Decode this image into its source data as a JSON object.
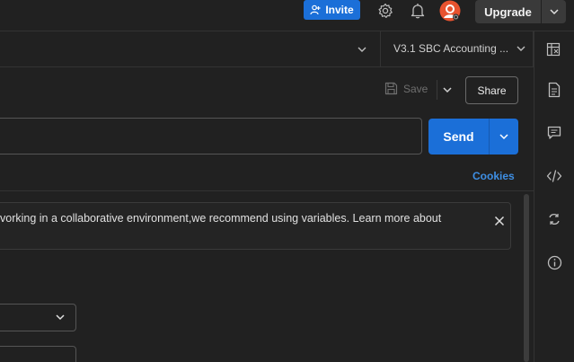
{
  "topbar": {
    "invite_label": "Invite",
    "upgrade_label": "Upgrade"
  },
  "environment": {
    "selected": "V3.1 SBC Accounting ..."
  },
  "request": {
    "save_label": "Save",
    "share_label": "Share",
    "url_value": "",
    "send_label": "Send",
    "cookies_label": "Cookies"
  },
  "banner": {
    "text": "vorking in a collaborative environment,we recommend using variables. Learn more about"
  },
  "colors": {
    "accent": "#1b6fd8",
    "link": "#3e8fe4",
    "avatar": "#e8532f",
    "background": "#212121"
  },
  "icons": {
    "invite": "add-user-icon",
    "settings": "gear-icon",
    "notifications": "bell-icon",
    "sidebar": [
      "document-icon",
      "comment-icon",
      "code-icon",
      "sync-icon",
      "info-icon"
    ]
  }
}
